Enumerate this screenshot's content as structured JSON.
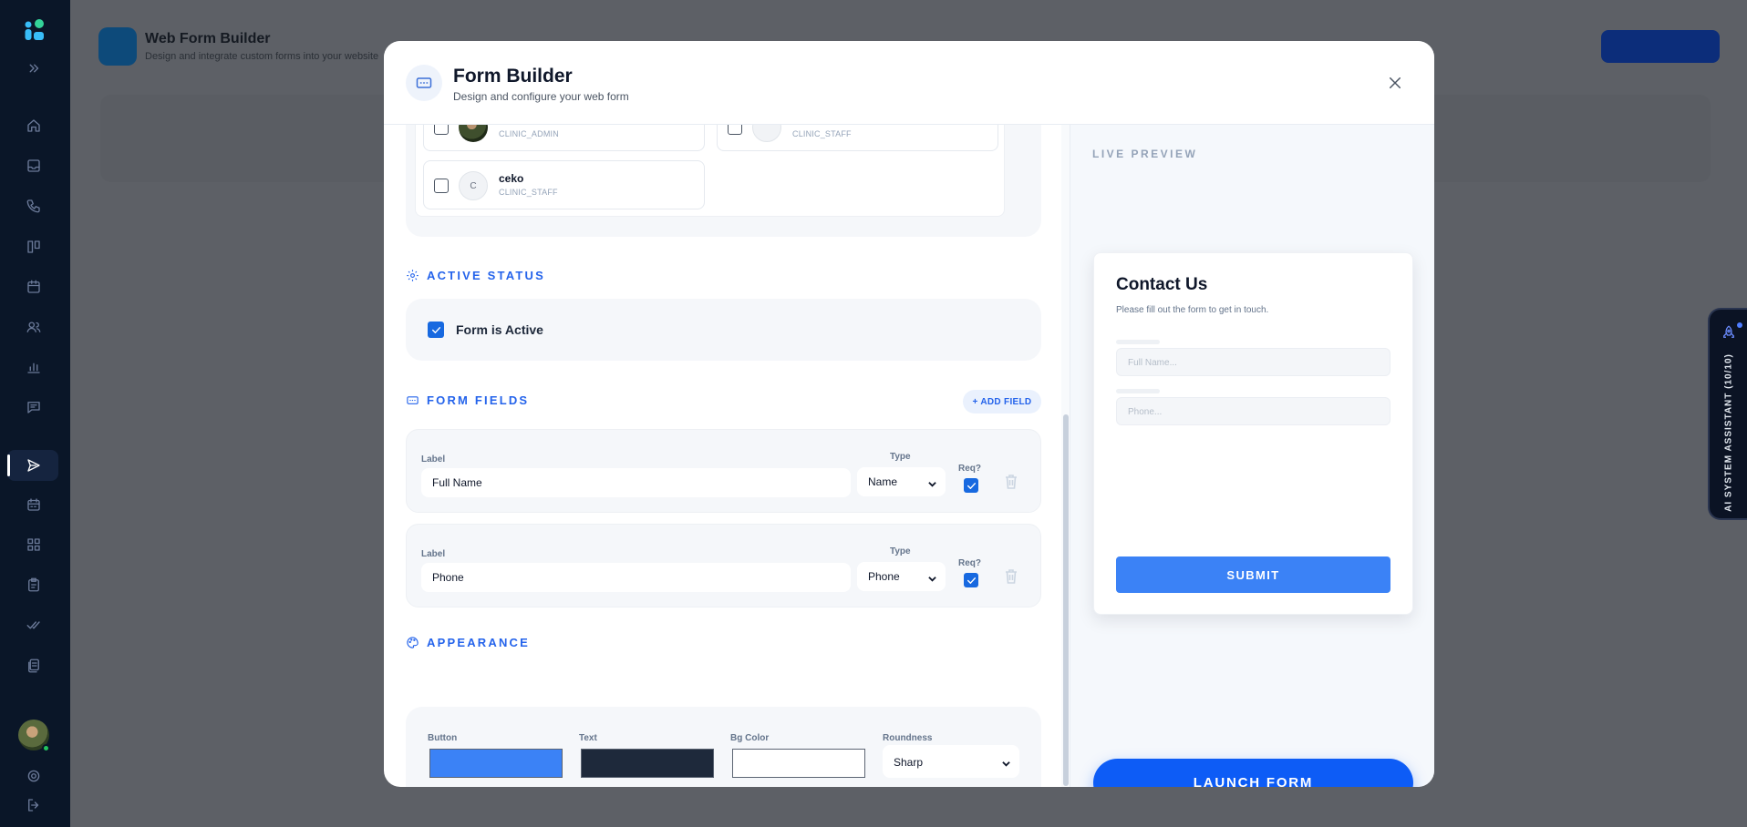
{
  "background_page": {
    "title": "Web Form Builder",
    "subtitle": "Design and integrate custom forms into your website"
  },
  "modal": {
    "title": "Form Builder",
    "subtitle": "Design and configure your web form"
  },
  "members": [
    {
      "name": "",
      "role": "CLINIC_ADMIN",
      "initial": "",
      "has_photo": true
    },
    {
      "name": "",
      "role": "CLINIC_STAFF",
      "initial": "",
      "has_photo": false
    },
    {
      "name": "ceko",
      "role": "CLINIC_STAFF",
      "initial": "C",
      "has_photo": false
    }
  ],
  "active_status": {
    "section_title": "ACTIVE STATUS",
    "label": "Form is Active",
    "checked": true
  },
  "form_fields": {
    "section_title": "FORM FIELDS",
    "add_label": "+ ADD FIELD",
    "col_label": "Label",
    "col_type": "Type",
    "col_required": "Req?",
    "fields": [
      {
        "label": "Full Name",
        "type": "Name",
        "required": true
      },
      {
        "label": "Phone",
        "type": "Phone",
        "required": true
      }
    ]
  },
  "appearance": {
    "section_title": "APPEARANCE",
    "button_label": "Button",
    "text_label": "Text",
    "bg_label": "Bg Color",
    "roundness_label": "Roundness",
    "button_color": "#3b82f6",
    "text_color": "#1e293b",
    "bg_color": "#ffffff",
    "roundness": "Sharp"
  },
  "preview": {
    "section_title": "LIVE PREVIEW",
    "form_title": "Contact Us",
    "form_description": "Please fill out the form to get in touch.",
    "placeholders": [
      "Full Name...",
      "Phone..."
    ],
    "submit_label": "SUBMIT"
  },
  "launch_label": "LAUNCH FORM",
  "assistant_label": "AI SYSTEM ASSISTANT (10/10)",
  "colors": {
    "accent": "#2463eb",
    "launch": "#0d5cf6",
    "sidebar": "#0a1628"
  }
}
